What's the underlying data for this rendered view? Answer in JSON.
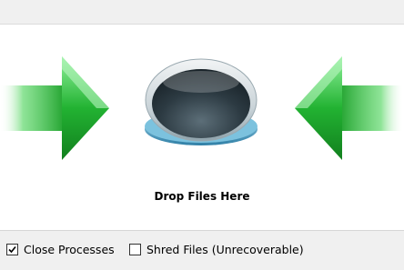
{
  "drop_zone": {
    "label": "Drop Files Here",
    "arrow_icon_left": "right-pointing-green-arrow",
    "arrow_icon_right": "left-pointing-green-arrow",
    "drop_button_icon": "glass-orb-drop-target"
  },
  "options": {
    "close_processes": {
      "label": "Close Processes",
      "checked": true
    },
    "shred_files": {
      "label": "Shred Files (Unrecoverable)",
      "checked": false
    }
  },
  "colors": {
    "arrow_green": "#1fa12c",
    "arrow_light_green": "#6fe07a",
    "orb_dark": "#233038",
    "orb_ring": "#5fa8c8",
    "bar_background": "#f0f0f0"
  }
}
